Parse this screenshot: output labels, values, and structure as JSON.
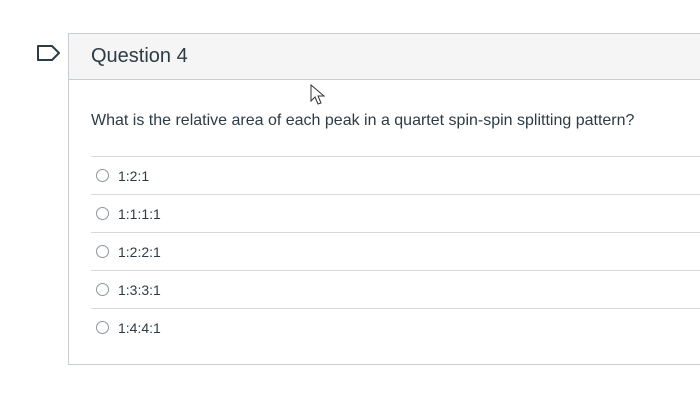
{
  "question": {
    "title": "Question 4",
    "text": "What is the relative area of each peak in a quartet spin-spin splitting pattern?"
  },
  "answers": [
    {
      "label": "1:2:1",
      "selected": false
    },
    {
      "label": "1:1:1:1",
      "selected": false
    },
    {
      "label": "1:2:2:1",
      "selected": false
    },
    {
      "label": "1:3:3:1",
      "selected": false
    },
    {
      "label": "1:4:4:1",
      "selected": false
    }
  ],
  "icons": {
    "flag": "flag-question-icon",
    "cursor": "mouse-pointer-icon"
  },
  "colors": {
    "text": "#2d3b45",
    "header_bg": "#f5f5f5",
    "border": "#c7cdd1"
  }
}
